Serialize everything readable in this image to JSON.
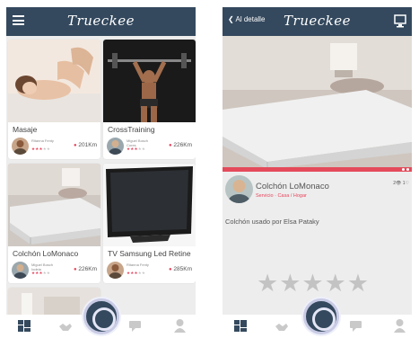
{
  "app": {
    "title": "Trueckee"
  },
  "list_screen": {
    "cards": [
      {
        "title": "Masaje",
        "user_name": "Ritanna Fenty",
        "user_sub": "",
        "distance": "201Km"
      },
      {
        "title": "CrossTraining",
        "user_name": "Miguel Bosch",
        "user_sub": "Cores",
        "distance": "226Km"
      },
      {
        "title": "Colchón LoMonaco",
        "user_name": "Miguel Bosch",
        "user_sub": "Iodela",
        "distance": "226Km"
      },
      {
        "title": "TV Samsung Led Retine",
        "user_name": "Ritanna Fenty",
        "user_sub": "",
        "distance": "285Km"
      }
    ],
    "nav": [
      "grid-icon",
      "handshake-icon",
      "home-fab",
      "chat-icon",
      "profile-icon"
    ]
  },
  "detail_screen": {
    "back_label": "Al detalle",
    "strip_label": "1 Activo",
    "item_title": "Colchón LoMonaco",
    "category": "Servicio · Casa / Hogar",
    "views": "2",
    "likes": "1",
    "description": "Colchón usado por Elsa Pataky",
    "rating_stars": "★★★★★"
  },
  "colors": {
    "appbar": "#34495e",
    "accent": "#e8455c",
    "background": "#ededed"
  }
}
